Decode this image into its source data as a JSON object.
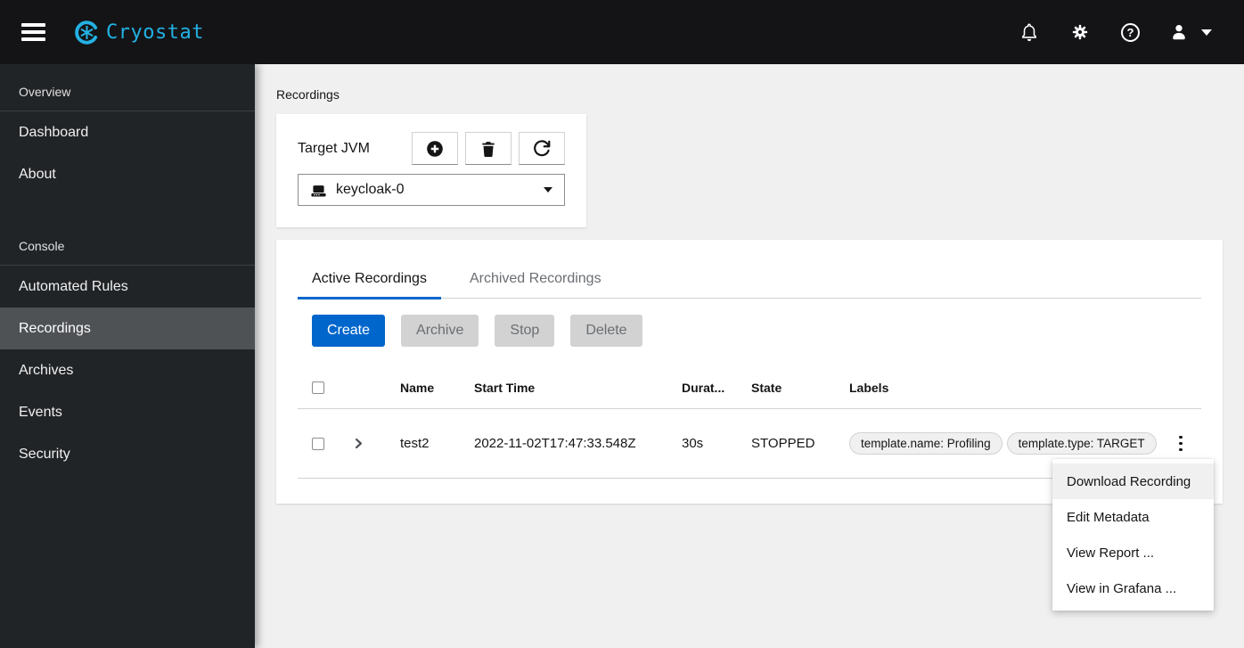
{
  "masthead": {
    "brand": "Cryostat"
  },
  "sidebar": {
    "groups": [
      {
        "title": "Overview",
        "items": [
          {
            "label": "Dashboard"
          },
          {
            "label": "About"
          }
        ]
      },
      {
        "title": "Console",
        "items": [
          {
            "label": "Automated Rules"
          },
          {
            "label": "Recordings"
          },
          {
            "label": "Archives"
          },
          {
            "label": "Events"
          },
          {
            "label": "Security"
          }
        ]
      }
    ],
    "selected": "Recordings"
  },
  "breadcrumb": "Recordings",
  "target_select": {
    "title": "Target JVM",
    "value": "keycloak-0"
  },
  "tabs": [
    {
      "label": "Active Recordings",
      "active": true
    },
    {
      "label": "Archived Recordings",
      "active": false
    }
  ],
  "toolbar": {
    "create": "Create",
    "archive": "Archive",
    "stop": "Stop",
    "delete": "Delete"
  },
  "table": {
    "columns": [
      "Name",
      "Start Time",
      "Durat...",
      "State",
      "Labels"
    ],
    "rows": [
      {
        "name": "test2",
        "start_time": "2022-11-02T17:47:33.548Z",
        "duration": "30s",
        "state": "STOPPED",
        "labels": [
          "template.name: Profiling",
          "template.type: TARGET"
        ]
      }
    ]
  },
  "kebab_menu": {
    "highlighted": "Download Recording",
    "items": [
      "Download Recording",
      "Edit Metadata",
      "View Report ...",
      "View in Grafana ..."
    ]
  },
  "colors": {
    "accent_blue": "#0066cc",
    "brand_cyan": "#23b1e3",
    "masthead_bg": "#141417",
    "sidebar_bg": "#212427",
    "nav_selected_bg": "#4f5255",
    "content_bg": "#f0f0f0",
    "disabled_bg": "#d2d2d2",
    "disabled_text": "#6a6e73"
  }
}
